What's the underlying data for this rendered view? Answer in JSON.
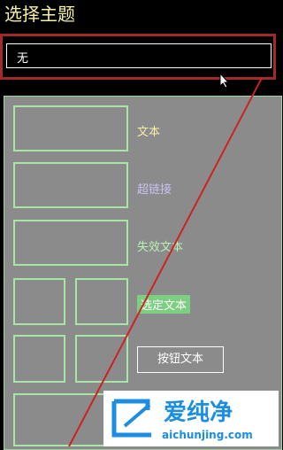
{
  "header": {
    "title": "选择主题"
  },
  "theme_select": {
    "value": "无"
  },
  "preview": {
    "items": [
      {
        "label": "文本"
      },
      {
        "label": "超链接"
      },
      {
        "label": "失效文本"
      },
      {
        "label": "选定文本"
      },
      {
        "label": "按钮文本"
      }
    ]
  },
  "watermark": {
    "name": "爱纯净",
    "url": "aichunjing.com"
  },
  "colors": {
    "title": "#f4f0a6",
    "highlight_border": "#a22a2a",
    "panel_bg": "#8b8b8b",
    "swatch_border": "#a8e6a8",
    "text": "#f4f0a6",
    "hyperlink": "#c9c0f0",
    "disabled": "#b9f0b5",
    "selected_bg": "#7ccf80",
    "annotation_line": "#cc2222"
  }
}
